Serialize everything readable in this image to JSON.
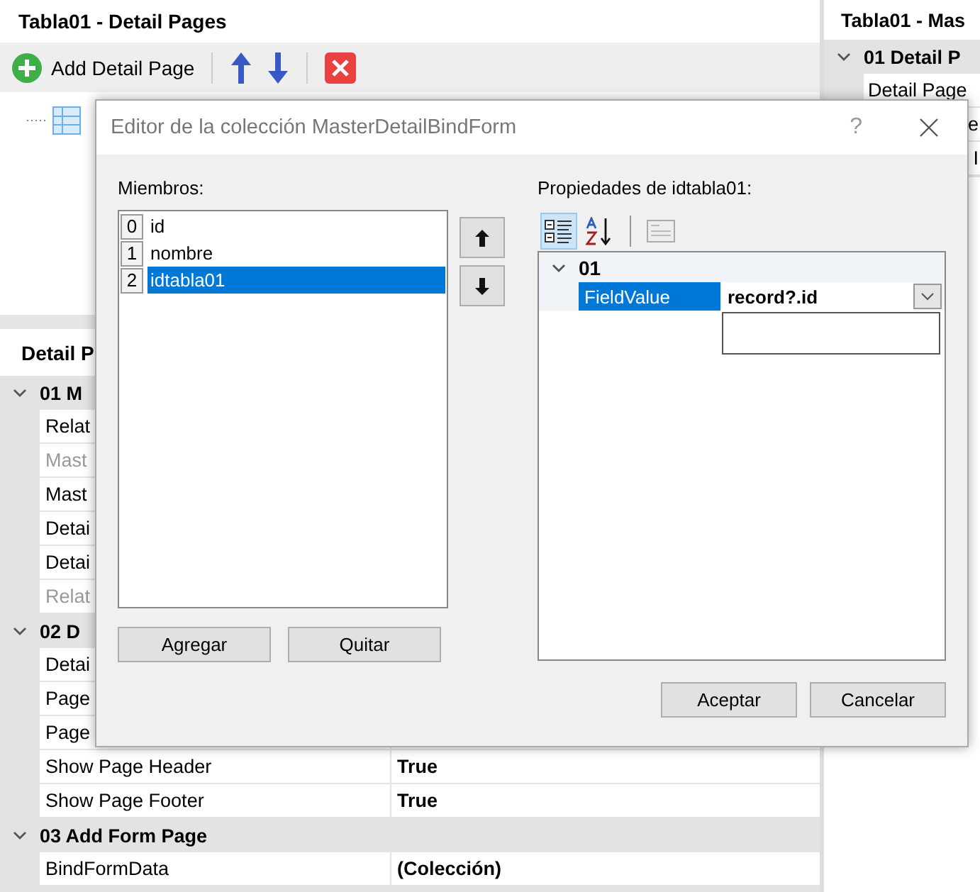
{
  "detail_pages_panel": {
    "title": "Tabla01 - Detail Pages",
    "toolbar": {
      "add_label": "Add Detail Page"
    }
  },
  "properties_panel": {
    "title": "Detail P",
    "categories": [
      {
        "name": "01 M",
        "expanded": true,
        "rows": [
          {
            "name": "Relat",
            "disabled": false
          },
          {
            "name": "Mast",
            "disabled": true
          },
          {
            "name": "Mast",
            "disabled": false
          },
          {
            "name": "Detai",
            "disabled": false
          },
          {
            "name": "Detai",
            "disabled": false
          },
          {
            "name": "Relat",
            "disabled": true
          }
        ]
      },
      {
        "name": "02 D",
        "expanded": true,
        "rows": [
          {
            "name": "Detai",
            "disabled": false
          },
          {
            "name": "Page",
            "disabled": false
          },
          {
            "name": "Page",
            "disabled": false
          },
          {
            "name": "Show Page Header",
            "value": "True",
            "disabled": false
          },
          {
            "name": "Show Page Footer",
            "value": "True",
            "disabled": false
          }
        ]
      },
      {
        "name": "03 Add Form Page",
        "expanded": true,
        "rows": [
          {
            "name": "BindFormData",
            "value": "(Colección)",
            "disabled": false
          }
        ]
      }
    ]
  },
  "master_panel": {
    "title": "Tabla01 - Mas",
    "categories": [
      {
        "name": "01 Detail P",
        "expanded": true,
        "rows": [
          {
            "name": "Detail Page",
            "kind": "full"
          },
          {
            "name": "e",
            "kind": "fragment"
          },
          {
            "name": "I",
            "kind": "fragment"
          }
        ]
      }
    ]
  },
  "dialog": {
    "title": "Editor de la colección MasterDetailBindForm",
    "help": "?",
    "members_label": "Miembros:",
    "members": [
      {
        "index": "0",
        "name": "id",
        "selected": false
      },
      {
        "index": "1",
        "name": "nombre",
        "selected": false
      },
      {
        "index": "2",
        "name": "idtabla01",
        "selected": true
      }
    ],
    "properties_label": "Propiedades de idtabla01:",
    "toolbar": {
      "categorized_selected": true,
      "alphabetical_selected": false
    },
    "property_grid": {
      "categories": [
        {
          "name": "01",
          "expanded": true,
          "rows": [
            {
              "name": "FieldValue",
              "value": "record?.id",
              "selected": true,
              "dropdown_open": true
            }
          ]
        }
      ]
    },
    "add_button": "Agregar",
    "remove_button": "Quitar",
    "ok_button": "Aceptar",
    "cancel_button": "Cancelar"
  }
}
